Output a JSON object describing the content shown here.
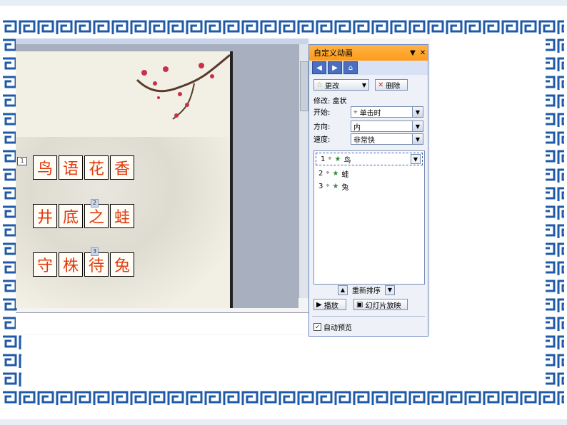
{
  "slide": {
    "marker": "1",
    "rows": [
      {
        "chars": [
          "鸟",
          "语",
          "花",
          "香"
        ],
        "tag_index": null,
        "tag": ""
      },
      {
        "chars": [
          "井",
          "底",
          "之",
          "蛙"
        ],
        "tag_index": 2,
        "tag": "2"
      },
      {
        "chars": [
          "守",
          "株",
          "待",
          "兔"
        ],
        "tag_index": 2,
        "tag": "3"
      }
    ]
  },
  "pane": {
    "title": "自定义动画",
    "change_btn": "更改",
    "delete_btn": "删除",
    "modify_label": "修改: 盒状",
    "start_label": "开始:",
    "start_value": "单击时",
    "direction_label": "方向:",
    "direction_value": "内",
    "speed_label": "速度:",
    "speed_value": "非常快",
    "items": [
      {
        "num": "1",
        "name": "鸟"
      },
      {
        "num": "2",
        "name": "蛙"
      },
      {
        "num": "3",
        "name": "兔"
      }
    ],
    "reorder_label": "重新排序",
    "play_btn": "播放",
    "slideshow_btn": "幻灯片放映",
    "autopreview_label": "自动预览"
  },
  "colors": {
    "border": "#1f5aa8",
    "char": "#e03a10",
    "pane_title": "#ff9b18"
  }
}
